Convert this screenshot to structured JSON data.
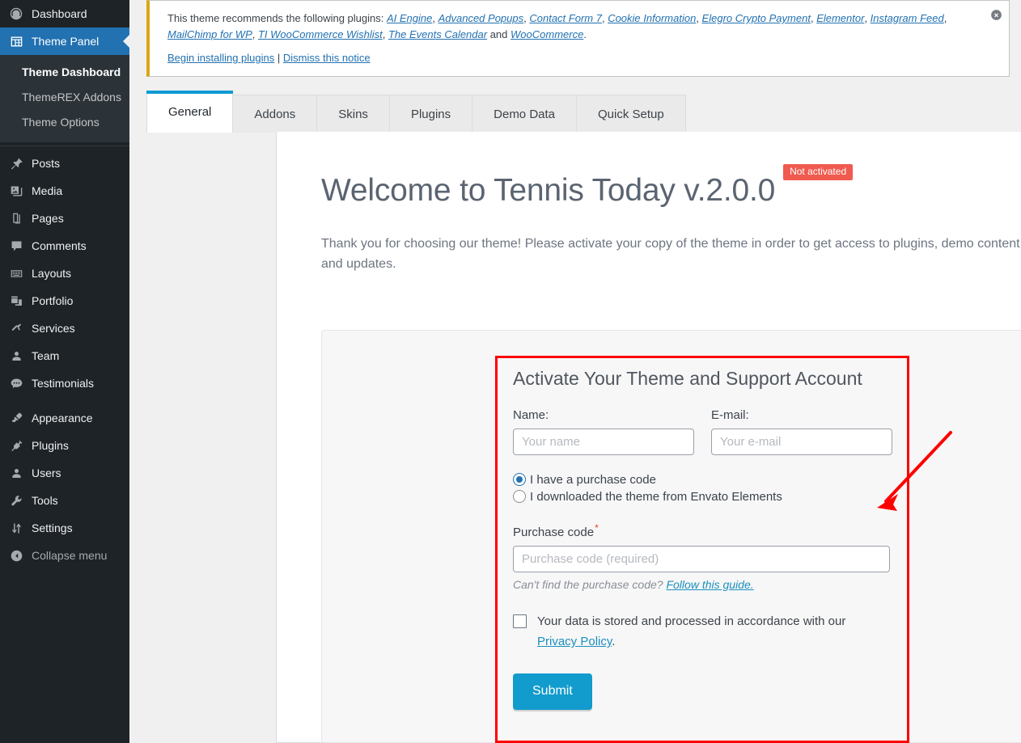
{
  "sidebar": {
    "items": [
      {
        "label": "Dashboard",
        "icon": "dashboard-icon",
        "name": "dashboard"
      },
      {
        "label": "Theme Panel",
        "icon": "theme-panel-icon",
        "name": "theme-panel"
      },
      {
        "label": "Posts",
        "icon": "pin-icon",
        "name": "posts"
      },
      {
        "label": "Media",
        "icon": "media-icon",
        "name": "media"
      },
      {
        "label": "Pages",
        "icon": "pages-icon",
        "name": "pages"
      },
      {
        "label": "Comments",
        "icon": "comment-icon",
        "name": "comments"
      },
      {
        "label": "Layouts",
        "icon": "layouts-icon",
        "name": "layouts"
      },
      {
        "label": "Portfolio",
        "icon": "portfolio-icon",
        "name": "portfolio"
      },
      {
        "label": "Services",
        "icon": "hammer-icon",
        "name": "services"
      },
      {
        "label": "Team",
        "icon": "user-icon",
        "name": "team"
      },
      {
        "label": "Testimonials",
        "icon": "testimonial-icon",
        "name": "testimonials"
      },
      {
        "label": "Appearance",
        "icon": "brush-icon",
        "name": "appearance"
      },
      {
        "label": "Plugins",
        "icon": "plug-icon",
        "name": "plugins"
      },
      {
        "label": "Users",
        "icon": "users-icon",
        "name": "users"
      },
      {
        "label": "Tools",
        "icon": "wrench-icon",
        "name": "tools"
      },
      {
        "label": "Settings",
        "icon": "sliders-icon",
        "name": "settings"
      },
      {
        "label": "Collapse menu",
        "icon": "collapse-icon",
        "name": "collapse-menu"
      }
    ],
    "submenu": [
      {
        "label": "Theme Dashboard",
        "current": true
      },
      {
        "label": "ThemeREX Addons",
        "current": false
      },
      {
        "label": "Theme Options",
        "current": false
      }
    ]
  },
  "notice": {
    "intro": "This theme recommends the following plugins:",
    "plugins": [
      "AI Engine",
      "Advanced Popups",
      "Contact Form 7",
      "Cookie Information",
      "Elegro Crypto Payment",
      "Elementor",
      "Instagram Feed",
      "MailChimp for WP",
      "TI WooCommerce Wishlist",
      "The Events Calendar",
      "WooCommerce"
    ],
    "conjunction": "and",
    "begin_install": "Begin installing plugins",
    "separator": "|",
    "dismiss": "Dismiss this notice",
    "dismiss_icon": "close-circle-icon",
    "accent_color": "#dba617"
  },
  "tabs": [
    {
      "label": "General",
      "active": true
    },
    {
      "label": "Addons",
      "active": false
    },
    {
      "label": "Skins",
      "active": false
    },
    {
      "label": "Plugins",
      "active": false
    },
    {
      "label": "Demo Data",
      "active": false
    },
    {
      "label": "Quick Setup",
      "active": false
    }
  ],
  "main": {
    "welcome_title": "Welcome to Tennis Today v.2.0.0",
    "status_badge": "Not activated",
    "status_badge_color": "#f05a4f",
    "intro_paragraph": "Thank you for choosing our theme! Please activate your copy of the theme in order to get access to plugins, demo content, support and updates."
  },
  "form": {
    "title": "Activate Your Theme and Support Account",
    "name_label": "Name:",
    "name_placeholder": "Your name",
    "name_value": "",
    "email_label": "E-mail:",
    "email_placeholder": "Your e-mail",
    "email_value": "",
    "radio_purchase_code": "I have a purchase code",
    "radio_envato_elements": "I downloaded the theme from Envato Elements",
    "purchase_code_label": "Purchase code",
    "required_marker": "*",
    "purchase_code_placeholder": "Purchase code (required)",
    "purchase_code_value": "",
    "hint_text": "Can't find the purchase code?",
    "hint_link": "Follow this guide.",
    "consent_text": "Your data is stored and processed in accordance with our",
    "consent_link": "Privacy Policy",
    "consent_period": ".",
    "submit_label": "Submit",
    "submit_color": "#129bcd"
  },
  "annotation": {
    "highlight_color": "#fe0000",
    "arrow": "red-arrow-pointing-to-activation-form"
  }
}
